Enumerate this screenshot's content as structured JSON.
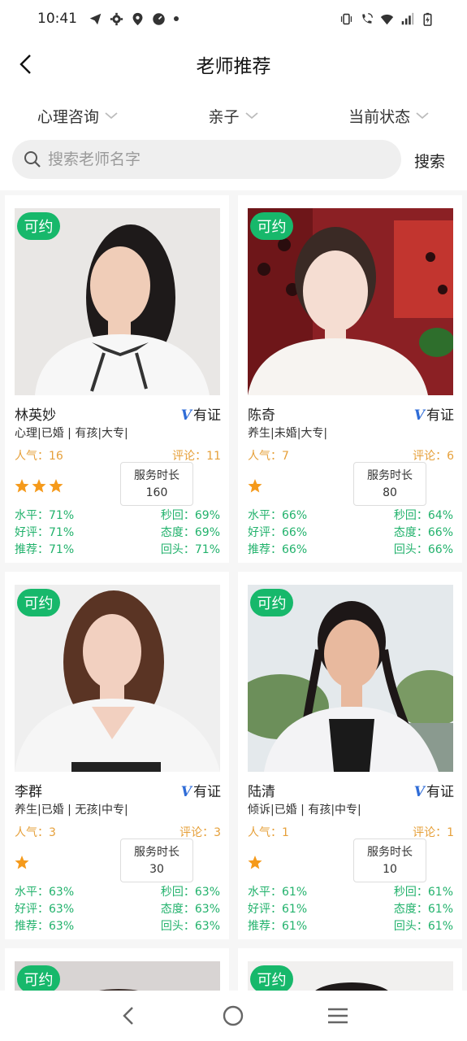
{
  "status_bar": {
    "time": "10:41",
    "left_icons": [
      "telegram-icon",
      "gear-icon",
      "location-icon",
      "speedometer-icon",
      "dot-icon"
    ],
    "right_icons": [
      "vibrate-icon",
      "wifi-call-icon",
      "wifi-icon",
      "signal-icon",
      "battery-icon"
    ]
  },
  "header": {
    "title": "老师推荐"
  },
  "filters": [
    {
      "label": "心理咨询"
    },
    {
      "label": "亲子"
    },
    {
      "label": "当前状态"
    }
  ],
  "search": {
    "placeholder": "搜索老师名字",
    "value": "",
    "button_label": "搜索"
  },
  "teachers": [
    {
      "badge": "可约",
      "name": "林英妙",
      "verified_mark": "V",
      "verified_label": "有证",
      "tags": "心理|已婚 | 有孩|大专|",
      "popularity": "人气：16",
      "comments": "评论：11",
      "stars": 3,
      "duration_label": "服务时长",
      "duration_value": "160",
      "level": "水平：71%",
      "reply": "秒回：69%",
      "rating": "好评：71%",
      "attitude": "态度：69%",
      "recommend": "推荐：71%",
      "returning": "回头：71%"
    },
    {
      "badge": "可约",
      "name": "陈奇",
      "verified_mark": "V",
      "verified_label": "有证",
      "tags": "养生|未婚|大专|",
      "popularity": "人气：7",
      "comments": "评论：6",
      "stars": 1,
      "duration_label": "服务时长",
      "duration_value": "80",
      "level": "水平：66%",
      "reply": "秒回：64%",
      "rating": "好评：66%",
      "attitude": "态度：66%",
      "recommend": "推荐：66%",
      "returning": "回头：66%"
    },
    {
      "badge": "可约",
      "name": "李群",
      "verified_mark": "V",
      "verified_label": "有证",
      "tags": "养生|已婚 | 无孩|中专|",
      "popularity": "人气：3",
      "comments": "评论：3",
      "stars": 1,
      "duration_label": "服务时长",
      "duration_value": "30",
      "level": "水平：63%",
      "reply": "秒回：63%",
      "rating": "好评：63%",
      "attitude": "态度：63%",
      "recommend": "推荐：63%",
      "returning": "回头：63%"
    },
    {
      "badge": "可约",
      "name": "陆清",
      "verified_mark": "V",
      "verified_label": "有证",
      "tags": "倾诉|已婚 | 有孩|中专|",
      "popularity": "人气：1",
      "comments": "评论：1",
      "stars": 1,
      "duration_label": "服务时长",
      "duration_value": "10",
      "level": "水平：61%",
      "reply": "秒回：61%",
      "rating": "好评：61%",
      "attitude": "态度：61%",
      "recommend": "推荐：61%",
      "returning": "回头：61%"
    },
    {
      "badge": "可约"
    },
    {
      "badge": "可约"
    }
  ],
  "colors": {
    "accent_green": "#17b86b",
    "metric_green": "#22b26c",
    "popularity_orange": "#e6a03a",
    "star_orange": "#f59a1b",
    "verified_blue": "#2f6cd7"
  },
  "bottom_nav": [
    "back-icon",
    "home-icon",
    "menu-icon"
  ]
}
